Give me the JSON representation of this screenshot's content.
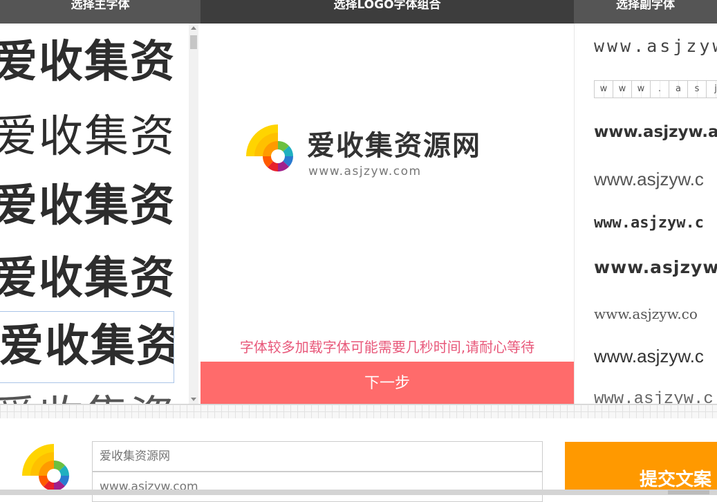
{
  "headers": {
    "main_font": "选择主字体",
    "logo_combo": "选择LOGO字体组合",
    "sub_font": "选择副字体"
  },
  "main_fonts": [
    {
      "text": "爱收集资"
    },
    {
      "text": "爱收集资"
    },
    {
      "text": "爱收集资"
    },
    {
      "text": "爱收集资源"
    },
    {
      "text": "爱收集资"
    },
    {
      "text": "爱收集资"
    }
  ],
  "preview": {
    "brand_name": "爱收集资源网",
    "url": "www.asjzyw.com",
    "notice": "字体较多加载字体可能需要几秒时间,请耐心等待",
    "next_label": "下一步"
  },
  "sub_fonts": [
    {
      "text": "www.asjzyw"
    },
    {
      "chars": [
        "w",
        "w",
        "w",
        ".",
        "a",
        "s",
        "j"
      ]
    },
    {
      "text": "www.asjzyw.a"
    },
    {
      "text": "www.asjzyw.c"
    },
    {
      "text": "www.asjzyw.c"
    },
    {
      "text": "www.asjzyw"
    },
    {
      "text": "www.asjzyw.co"
    },
    {
      "text": "www.asjzyw.c"
    },
    {
      "text": "www.asjzyw.c"
    }
  ],
  "form": {
    "brand_placeholder": "爱收集资源网",
    "url_placeholder": "www.asjzyw.com",
    "submit_label": "提交文案"
  },
  "colors": {
    "accent_red": "#ff6b6b",
    "accent_orange": "#ff9900",
    "notice_pink": "#e8587a",
    "header_dark": "#444444"
  }
}
